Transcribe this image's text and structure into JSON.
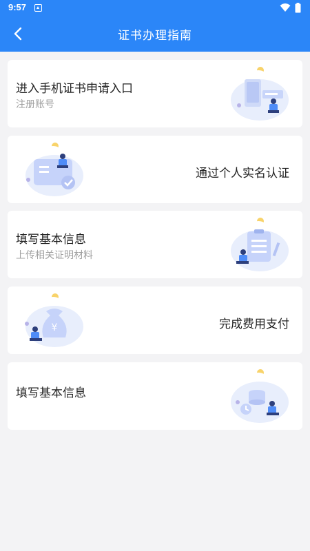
{
  "status_bar": {
    "time": "9:57"
  },
  "header": {
    "title": "证书办理指南"
  },
  "icons": {
    "back": "chevron-left-icon",
    "wifi": "wifi-icon",
    "battery": "battery-icon",
    "notification": "notification-icon"
  },
  "colors": {
    "primary": "#2b86f8",
    "background": "#f3f3f5",
    "card": "#ffffff",
    "title_text": "#222222",
    "subtitle_text": "#a0a0a0"
  },
  "steps": [
    {
      "title": "进入手机证书申请入口",
      "subtitle": "注册账号",
      "illustration": "phone-register-illustration"
    },
    {
      "title": "通过个人实名认证",
      "subtitle": "",
      "illustration": "id-card-verify-illustration"
    },
    {
      "title": "填写基本信息",
      "subtitle": "上传相关证明材料",
      "illustration": "clipboard-form-illustration"
    },
    {
      "title": "完成费用支付",
      "subtitle": "",
      "illustration": "money-bag-illustration"
    },
    {
      "title": "填写基本信息",
      "subtitle": "",
      "illustration": "coins-clock-illustration"
    }
  ]
}
